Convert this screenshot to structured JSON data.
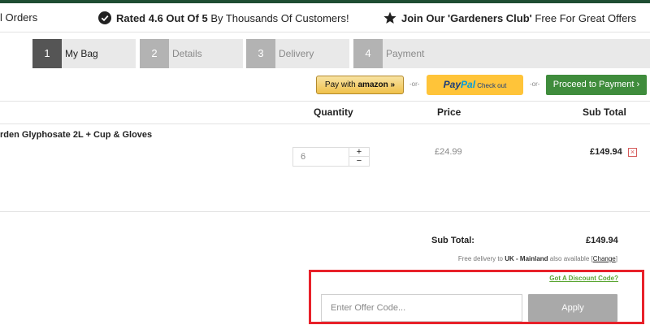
{
  "promo": {
    "orders_text": "l Orders",
    "rating_bold": "Rated 4.6 Out Of 5",
    "rating_rest": " By Thousands Of Customers!",
    "club_bold": "Join Our 'Gardeners Club'",
    "club_rest": " Free For Great Offers",
    "icons": [
      "check-circle-icon",
      "star-icon"
    ]
  },
  "steps": [
    {
      "num": "1",
      "label": "My Bag",
      "active": true
    },
    {
      "num": "2",
      "label": "Details",
      "active": false
    },
    {
      "num": "3",
      "label": "Delivery",
      "active": false
    },
    {
      "num": "4",
      "label": "Payment",
      "active": false
    }
  ],
  "checkout": {
    "amazon_prefix": "Pay with ",
    "amazon_brand": "amazon",
    "amazon_chevrons": "»",
    "or_left": "-or-",
    "paypal_pay": "Pay",
    "paypal_pal": "Pal",
    "paypal_suffix": "Check out",
    "or_right": "-or-",
    "proceed_label": "Proceed to Payment ›"
  },
  "table": {
    "headers": {
      "quantity": "Quantity",
      "price": "Price",
      "subtotal": "Sub Total"
    },
    "items": [
      {
        "name": "rden Glyphosate 2L + Cup & Gloves",
        "quantity": "6",
        "price": "£24.99",
        "subtotal": "£149.94"
      }
    ]
  },
  "qty_controls": {
    "plus": "+",
    "minus": "−"
  },
  "remove_glyph": "×",
  "summary": {
    "subtotal_label": "Sub Total:",
    "subtotal_value": "£149.94",
    "delivery_prefix": "Free delivery to ",
    "delivery_region": "UK - Mainland",
    "delivery_suffix": " also available [",
    "delivery_change": "Change",
    "delivery_close": "]"
  },
  "discount": {
    "link_label": "Got A Discount Code?",
    "input_placeholder": "Enter Offer Code...",
    "input_value": "",
    "apply_label": "Apply"
  },
  "colors": {
    "brand_green": "#1f4d32",
    "proceed_green": "#3f8c3c",
    "highlight_red": "#e8212a",
    "paypal_yellow": "#ffc439",
    "amazon_gold": "#f0c14b"
  }
}
